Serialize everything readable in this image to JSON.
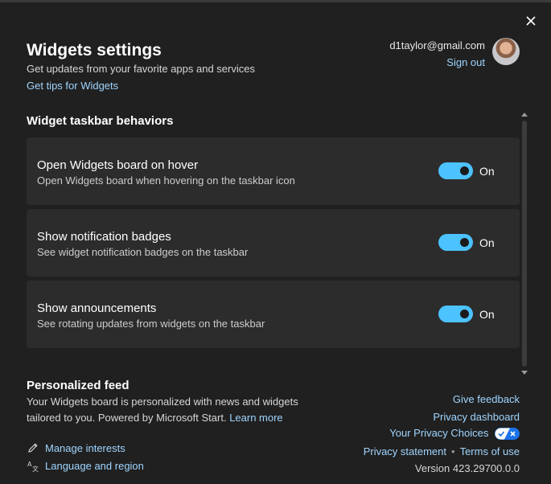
{
  "window": {
    "close_icon": "close-icon"
  },
  "header": {
    "title": "Widgets settings",
    "subtitle": "Get updates from your favorite apps and services",
    "tips_link": "Get tips for Widgets"
  },
  "account": {
    "email": "d1taylor@gmail.com",
    "sign_out": "Sign out"
  },
  "taskbar_section": {
    "header": "Widget taskbar behaviors",
    "items": [
      {
        "title": "Open Widgets board on hover",
        "description": "Open Widgets board when hovering on the taskbar icon",
        "state": "On",
        "enabled": true
      },
      {
        "title": "Show notification badges",
        "description": "See widget notification badges on the taskbar",
        "state": "On",
        "enabled": true
      },
      {
        "title": "Show announcements",
        "description": "See rotating updates from widgets on the taskbar",
        "state": "On",
        "enabled": true
      }
    ]
  },
  "feed": {
    "title": "Personalized feed",
    "description": "Your Widgets board is personalized with news and widgets tailored to you. Powered by Microsoft Start.",
    "learn_more": "Learn more"
  },
  "links": {
    "manage_interests": "Manage interests",
    "language_region": "Language and region"
  },
  "footer": {
    "give_feedback": "Give feedback",
    "privacy_dashboard": "Privacy dashboard",
    "privacy_choices": "Your Privacy Choices",
    "privacy_statement": "Privacy statement",
    "terms_of_use": "Terms of use",
    "version": "Version 423.29700.0.0"
  },
  "colors": {
    "background": "#202020",
    "card": "#2c2c2c",
    "accent": "#4cc2ff",
    "link": "#9fd5ff"
  }
}
